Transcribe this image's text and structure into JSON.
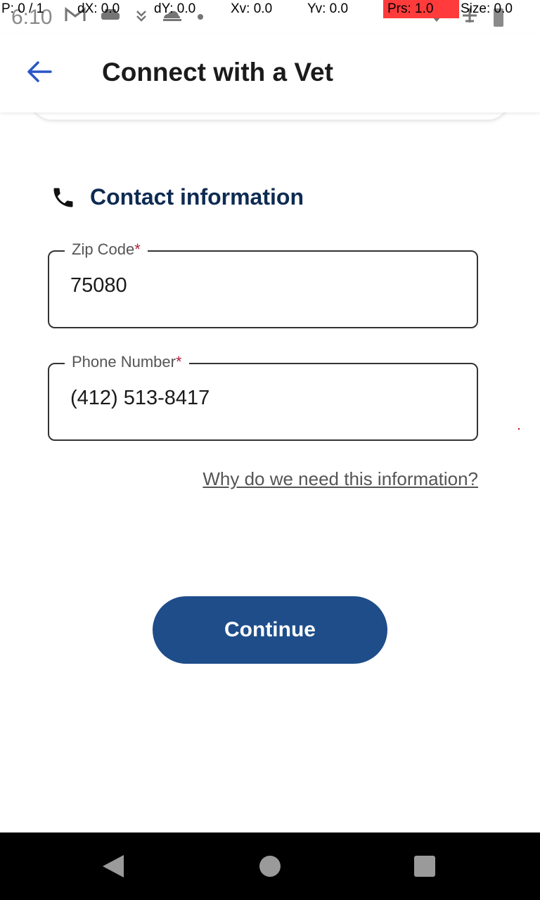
{
  "status_bar": {
    "clock": "6:10",
    "icons": [
      "gmail-icon",
      "car-icon",
      "download-icon",
      "cloud-icon",
      "dot-icon"
    ],
    "right_icons": [
      "wifi-icon",
      "airplane-icon",
      "battery-icon"
    ]
  },
  "pointer_overlay": {
    "p": "P: 0 / 1",
    "dx": "dX: 0.0",
    "dy": "dY: 0.0",
    "xv": "Xv: 0.0",
    "yv": "Yv: 0.0",
    "prs": "Prs: 1.0",
    "size": "Size: 0.0"
  },
  "app_bar": {
    "title": "Connect with a Vet",
    "back_icon": "arrow-left-icon"
  },
  "section": {
    "icon": "phone-icon",
    "title": "Contact information"
  },
  "fields": {
    "zip": {
      "label": "Zip Code",
      "required_mark": "*",
      "value": "75080"
    },
    "phone": {
      "label": "Phone Number",
      "required_mark": "*",
      "value": "(412) 513-8417"
    }
  },
  "why_link": "Why do we need this information?",
  "continue_label": "Continue",
  "colors": {
    "accent": "#1e4d8a",
    "heading": "#0e2b52",
    "required": "#b3223a",
    "back_arrow": "#2a55c7"
  },
  "nav_bar": {
    "icons": [
      "nav-back-icon",
      "nav-home-icon",
      "nav-recents-icon"
    ]
  }
}
